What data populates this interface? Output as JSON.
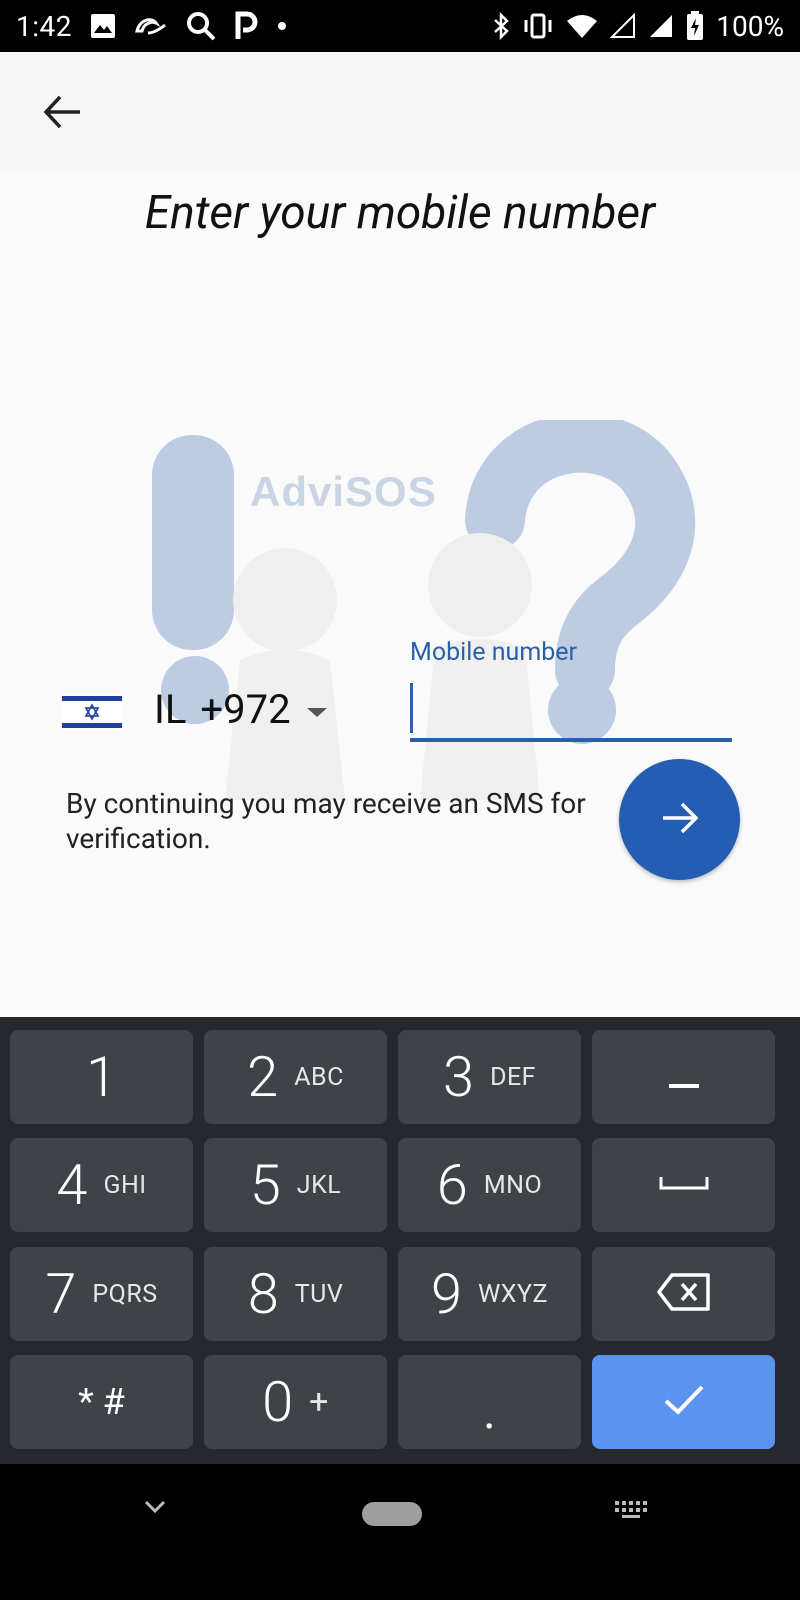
{
  "status_bar": {
    "time": "1:42",
    "battery": "100%",
    "icons": [
      "image-icon",
      "alibaba-icon",
      "search-icon",
      "p-icon",
      "dot-icon",
      "bluetooth-icon",
      "vibrate-icon",
      "wifi-icon",
      "signal-icon",
      "signal-icon",
      "battery-charging-icon"
    ]
  },
  "page": {
    "title": "Enter your mobile number",
    "watermark_text": "AdviSOS"
  },
  "phone_form": {
    "country_iso": "IL",
    "dial_code": "+972",
    "mobile_label": "Mobile number",
    "mobile_value": "",
    "sms_notice": "By continuing you may receive an SMS for verification."
  },
  "keyboard": {
    "keys": [
      {
        "num": "1",
        "letters": ""
      },
      {
        "num": "2",
        "letters": "ABC"
      },
      {
        "num": "3",
        "letters": "DEF"
      },
      {
        "num": "–",
        "letters": ""
      },
      {
        "num": "4",
        "letters": "GHI"
      },
      {
        "num": "5",
        "letters": "JKL"
      },
      {
        "num": "6",
        "letters": "MNO"
      },
      {
        "num": "␣",
        "letters": ""
      },
      {
        "num": "7",
        "letters": "PQRS"
      },
      {
        "num": "8",
        "letters": "TUV"
      },
      {
        "num": "9",
        "letters": "WXYZ"
      },
      {
        "num": "⌫",
        "letters": ""
      },
      {
        "num": "* #",
        "letters": ""
      },
      {
        "num": "0",
        "letters": "+"
      },
      {
        "num": ".",
        "letters": ""
      },
      {
        "num": "✓",
        "letters": ""
      }
    ],
    "action_color": "#5b93f0"
  },
  "colors": {
    "accent": "#255db3",
    "label": "#2b5fa8"
  }
}
